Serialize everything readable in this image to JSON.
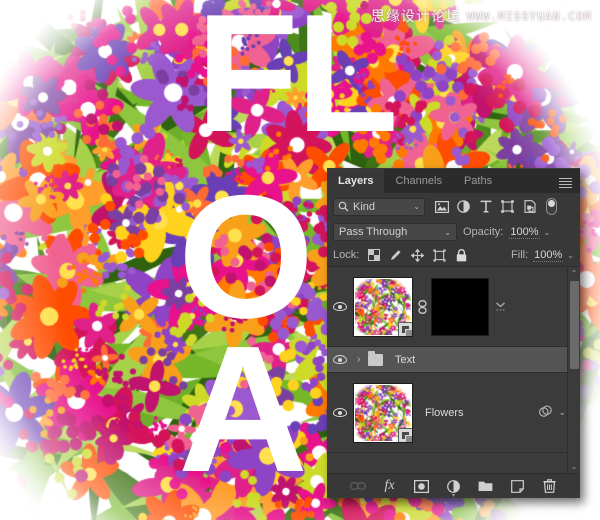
{
  "watermark": {
    "site_cn": "思缘设计论坛",
    "site_url": "WWW.MISSYUAN.COM"
  },
  "canvas": {
    "letters": [
      "F",
      "L",
      "O",
      "A"
    ],
    "letter_color": "#ffffff",
    "background": "floral-bouquet-photo"
  },
  "panel": {
    "tabs": [
      {
        "label": "Layers",
        "active": true
      },
      {
        "label": "Channels",
        "active": false
      },
      {
        "label": "Paths",
        "active": false
      }
    ],
    "menu_icon": "hamburger-menu-icon",
    "filter": {
      "kind_label": "Kind",
      "search_icon": "search-icon",
      "caret": "⌄",
      "icons": [
        "pixel-layer-filter-icon",
        "adjustment-layer-filter-icon",
        "type-layer-filter-icon",
        "shape-layer-filter-icon",
        "smart-object-filter-icon",
        "filter-toggle-switch"
      ]
    },
    "blend": {
      "mode": "Pass Through",
      "caret": "⌄",
      "opacity_label": "Opacity:",
      "opacity_value": "100%",
      "opacity_caret": "⌄"
    },
    "lock": {
      "label": "Lock:",
      "icons": [
        "lock-transparent-pixels-icon",
        "lock-image-pixels-icon",
        "lock-position-icon",
        "lock-artboard-nesting-icon",
        "lock-all-icon"
      ],
      "fill_label": "Fill:",
      "fill_value": "100%",
      "fill_caret": "⌄"
    },
    "layers": [
      {
        "name": "",
        "visible": true,
        "visibility_icon": "eye-icon",
        "thumbnail": "flower-bouquet-thumbnail",
        "has_smart_object_badge": true,
        "link_icon": "mask-link-icon",
        "mask": "black-layer-mask",
        "right_icon": "layer-options-ellipsis",
        "chevron": "⌄",
        "selected": false,
        "type": "smart-object-with-mask"
      },
      {
        "name": "Text",
        "visible": true,
        "visibility_icon": "eye-icon",
        "disclosure": "›",
        "folder_icon": "layer-group-folder-icon",
        "selected": true,
        "type": "group"
      },
      {
        "name": "Flowers",
        "visible": true,
        "visibility_icon": "eye-icon",
        "thumbnail": "flower-bouquet-thumbnail",
        "has_smart_object_badge": true,
        "right_icon": "layer-effects-icon",
        "chevron": "⌄",
        "selected": false,
        "type": "smart-object"
      }
    ],
    "scrollbar": {
      "up_arrow": "⌃",
      "down_arrow": "⌄"
    },
    "footer_buttons": [
      {
        "name": "link-layers-button",
        "glyph": "link",
        "disabled": true
      },
      {
        "name": "add-layer-style-button",
        "glyph": "fx",
        "disabled": false,
        "has_caret": false
      },
      {
        "name": "add-layer-mask-button",
        "glyph": "mask",
        "disabled": false,
        "has_caret": false
      },
      {
        "name": "new-adjustment-layer-button",
        "glyph": "adjustment",
        "disabled": false,
        "has_caret": true
      },
      {
        "name": "new-group-button",
        "glyph": "folder",
        "disabled": false,
        "has_caret": false
      },
      {
        "name": "new-layer-button",
        "glyph": "new-layer",
        "disabled": false,
        "has_caret": false
      },
      {
        "name": "delete-layer-button",
        "glyph": "trash",
        "disabled": false,
        "has_caret": false
      }
    ]
  },
  "colors": {
    "panel_bg": "#383838",
    "list_bg": "#3b3b3b",
    "selected_row": "#545454",
    "tab_bg": "#2b2b2b",
    "text": "#dcdcdc"
  }
}
